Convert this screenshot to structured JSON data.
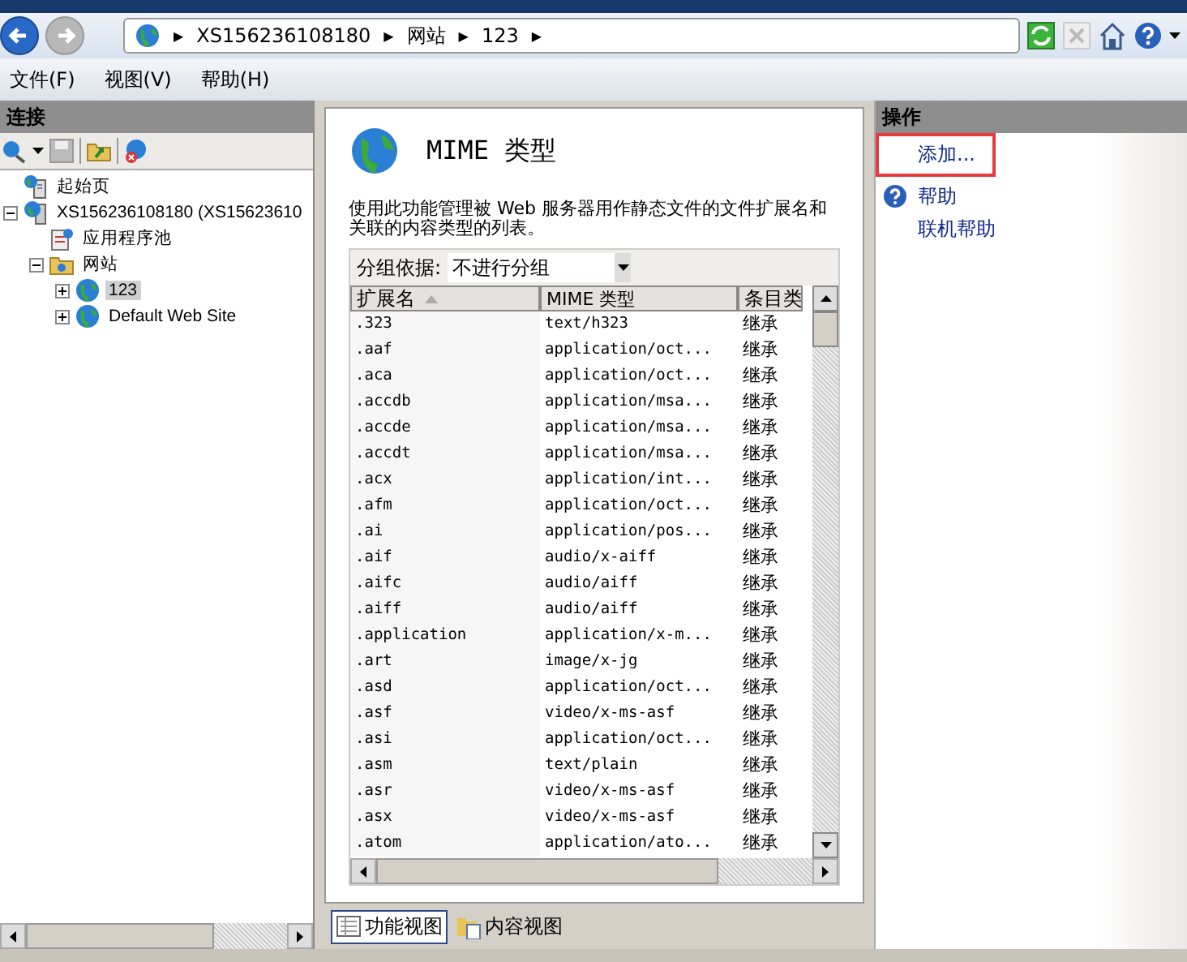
{
  "address_bar": {
    "breadcrumbs": [
      "XS156236108180",
      "网站",
      "123"
    ],
    "separator": "▶"
  },
  "menu": [
    "文件(F)",
    "视图(V)",
    "帮助(H)"
  ],
  "connections": {
    "title": "连接",
    "tree": [
      {
        "label": "起始页",
        "kind": "start",
        "selected": false
      },
      {
        "label": "XS156236108180 (XS15623610",
        "kind": "server",
        "expanded": true,
        "selected": false,
        "children": [
          {
            "label": "应用程序池",
            "kind": "pool",
            "selected": false
          },
          {
            "label": "网站",
            "kind": "sites",
            "expanded": true,
            "selected": false,
            "children": [
              {
                "label": "123",
                "kind": "site",
                "expanded": false,
                "selected": true
              },
              {
                "label": "Default Web Site",
                "kind": "site",
                "expanded": false,
                "selected": false
              }
            ]
          }
        ]
      }
    ]
  },
  "feature": {
    "title": "MIME 类型",
    "description": "使用此功能管理被 Web 服务器用作静态文件的文件扩展名和关联的内容类型的列表。",
    "group_by_label": "分组依据:",
    "group_by_value": "不进行分组",
    "table": {
      "columns": [
        "扩展名",
        "MIME 类型",
        "条目类"
      ],
      "rows": [
        [
          ".323",
          "text/h323",
          "继承"
        ],
        [
          ".aaf",
          "application/oct...",
          "继承"
        ],
        [
          ".aca",
          "application/oct...",
          "继承"
        ],
        [
          ".accdb",
          "application/msa...",
          "继承"
        ],
        [
          ".accde",
          "application/msa...",
          "继承"
        ],
        [
          ".accdt",
          "application/msa...",
          "继承"
        ],
        [
          ".acx",
          "application/int...",
          "继承"
        ],
        [
          ".afm",
          "application/oct...",
          "继承"
        ],
        [
          ".ai",
          "application/pos...",
          "继承"
        ],
        [
          ".aif",
          "audio/x-aiff",
          "继承"
        ],
        [
          ".aifc",
          "audio/aiff",
          "继承"
        ],
        [
          ".aiff",
          "audio/aiff",
          "继承"
        ],
        [
          ".application",
          "application/x-m...",
          "继承"
        ],
        [
          ".art",
          "image/x-jg",
          "继承"
        ],
        [
          ".asd",
          "application/oct...",
          "继承"
        ],
        [
          ".asf",
          "video/x-ms-asf",
          "继承"
        ],
        [
          ".asi",
          "application/oct...",
          "继承"
        ],
        [
          ".asm",
          "text/plain",
          "继承"
        ],
        [
          ".asr",
          "video/x-ms-asf",
          "继承"
        ],
        [
          ".asx",
          "video/x-ms-asf",
          "继承"
        ],
        [
          ".atom",
          "application/ato...",
          "继承"
        ]
      ]
    },
    "views": [
      {
        "label": "功能视图",
        "selected": true
      },
      {
        "label": "内容视图",
        "selected": false
      }
    ]
  },
  "actions": {
    "title": "操作",
    "items": [
      {
        "label": "添加...",
        "highlighted": true
      },
      {
        "label": "帮助",
        "highlighted": false
      },
      {
        "label": "联机帮助",
        "highlighted": false
      }
    ]
  }
}
